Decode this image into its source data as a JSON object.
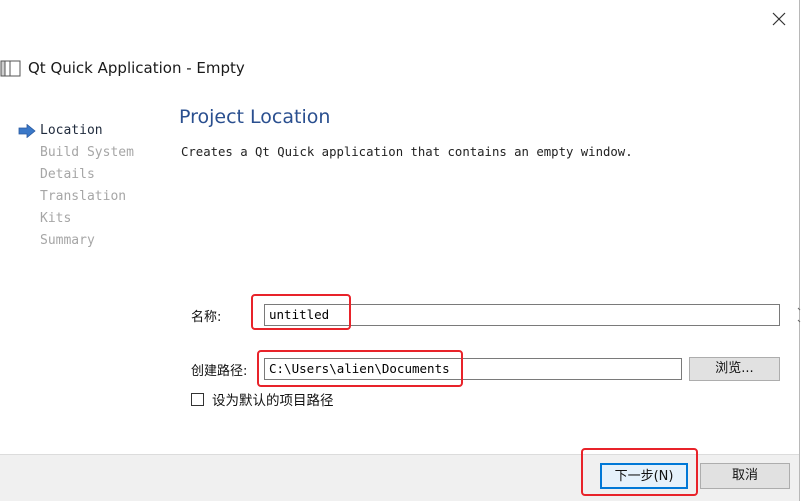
{
  "window": {
    "title": "Qt Quick Application - Empty",
    "close_icon": "close-icon",
    "title_icon": "wizard-document-icon"
  },
  "steps": [
    {
      "label": "Location",
      "active": true
    },
    {
      "label": "Build System",
      "active": false
    },
    {
      "label": "Details",
      "active": false
    },
    {
      "label": "Translation",
      "active": false
    },
    {
      "label": "Kits",
      "active": false
    },
    {
      "label": "Summary",
      "active": false
    }
  ],
  "page": {
    "title": "Project Location",
    "description": "Creates a Qt Quick application that contains an empty window."
  },
  "form": {
    "name_label": "名称:",
    "name_value": "untitled",
    "path_label": "创建路径:",
    "path_value": "C:\\Users\\alien\\Documents",
    "browse_label": "浏览...",
    "default_path_checkbox_label": "设为默认的项目路径",
    "default_path_checked": false
  },
  "footer": {
    "next_label": "下一步(N)",
    "cancel_label": "取消"
  },
  "colors": {
    "title_blue": "#2a4f8f",
    "active_arrow": "#3a78c8",
    "annotation_red": "#e8232a",
    "default_button_border": "#0078d7"
  }
}
